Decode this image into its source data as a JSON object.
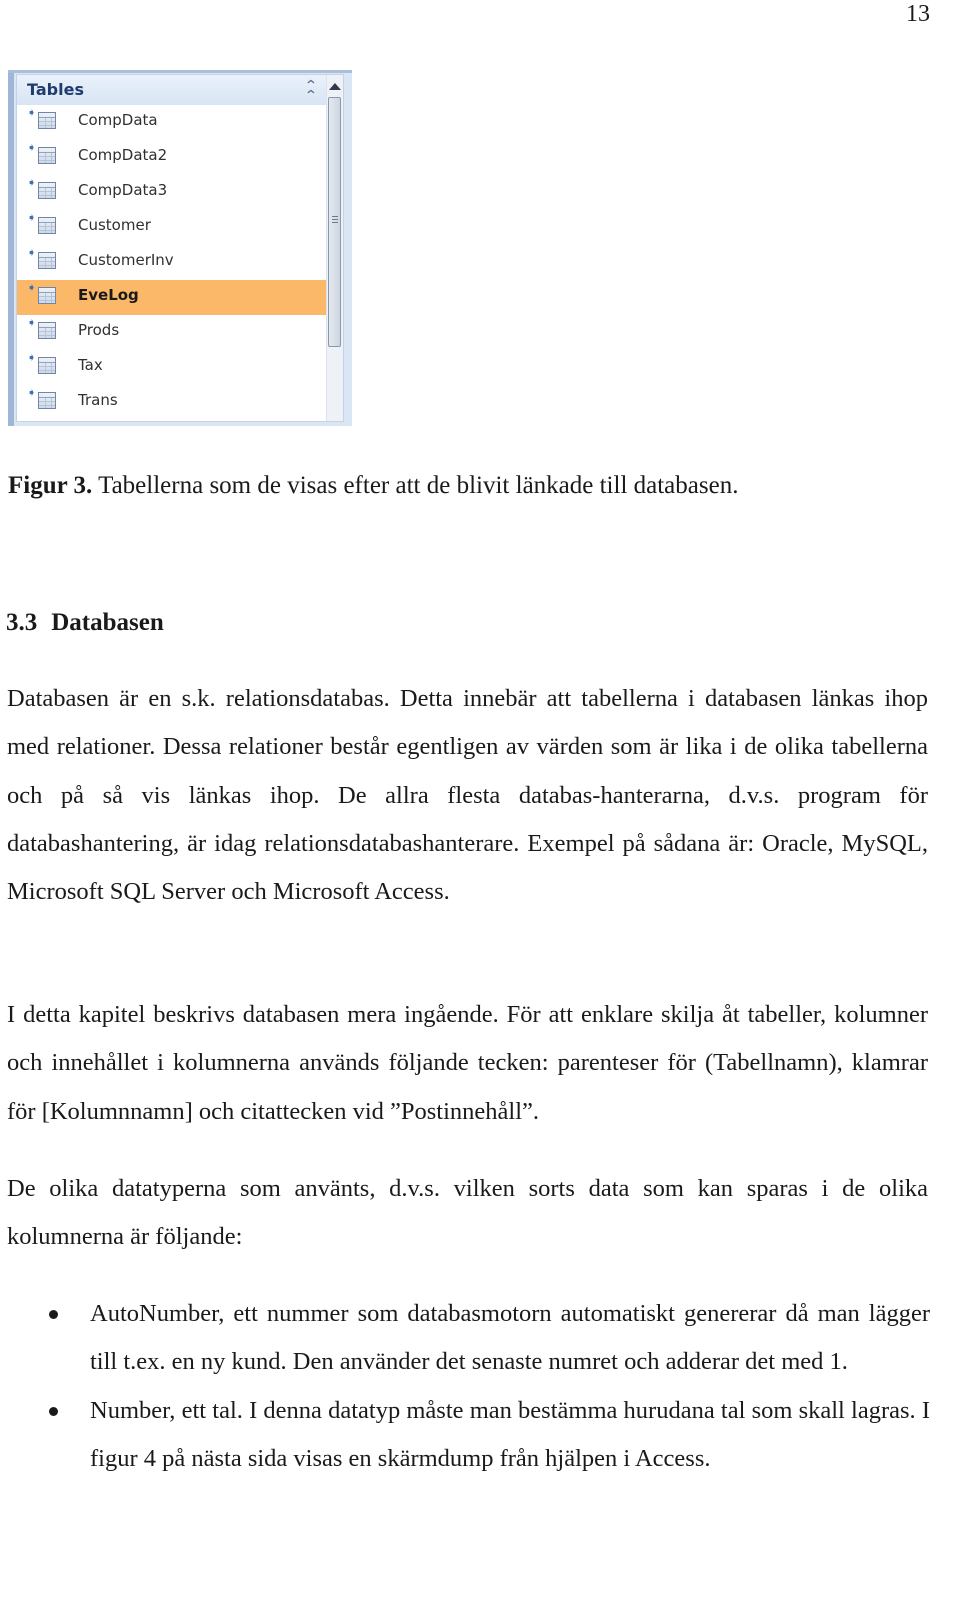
{
  "page": {
    "number": "13"
  },
  "figure": {
    "nav_pane": {
      "header": "Tables",
      "collapse_icon": "double-chevron-up-icon",
      "items": [
        {
          "label": "CompData",
          "icon": "table-icon",
          "selected": false
        },
        {
          "label": "CompData2",
          "icon": "table-icon",
          "selected": false
        },
        {
          "label": "CompData3",
          "icon": "table-icon",
          "selected": false
        },
        {
          "label": "Customer",
          "icon": "table-icon",
          "selected": false
        },
        {
          "label": "CustomerInv",
          "icon": "table-icon",
          "selected": false
        },
        {
          "label": "EveLog",
          "icon": "table-icon",
          "selected": true
        },
        {
          "label": "Prods",
          "icon": "table-icon",
          "selected": false
        },
        {
          "label": "Tax",
          "icon": "table-icon",
          "selected": false
        },
        {
          "label": "Trans",
          "icon": "table-icon",
          "selected": false
        }
      ],
      "linked_marker": "➧",
      "colors": {
        "selected_bg": "#fbb868",
        "header_text": "#1f3c6e"
      }
    },
    "caption": {
      "label": "Figur 3.",
      "text": " Tabellerna som de visas efter att de blivit länkade till databasen."
    }
  },
  "section": {
    "number": "3.3",
    "title": "Databasen"
  },
  "paragraphs": [
    "Databasen är en s.k. relationsdatabas. Detta innebär att tabellerna i databasen länkas ihop med relationer. Dessa relationer består egentligen av värden som är lika i de olika tabellerna och på så vis länkas ihop. De allra flesta databas-hanterarna, d.v.s. program för databashantering, är idag relationsdatabashanterare. Exempel på sådana är: Oracle, MySQL, Microsoft SQL Server och Microsoft Access.",
    "I detta kapitel beskrivs databasen mera ingående. För att enklare skilja åt tabeller, kolumner och innehållet i kolumnerna används följande tecken: parenteser för (Tabellnamn), klamrar för [Kolumnnamn] och citattecken vid ”Postinnehåll”.",
    "De olika datatyperna som använts, d.v.s. vilken sorts data som kan sparas i de olika kolumnerna är följande:"
  ],
  "bullets": [
    "AutoNumber, ett nummer som databasmotorn automatiskt genererar då man lägger till t.ex. en ny kund. Den använder det senaste numret och adderar det med 1.",
    "Number, ett tal. I denna datatyp måste man bestämma hurudana tal som skall lagras. I figur 4 på nästa sida visas en skärmdump från hjälpen i Access."
  ]
}
